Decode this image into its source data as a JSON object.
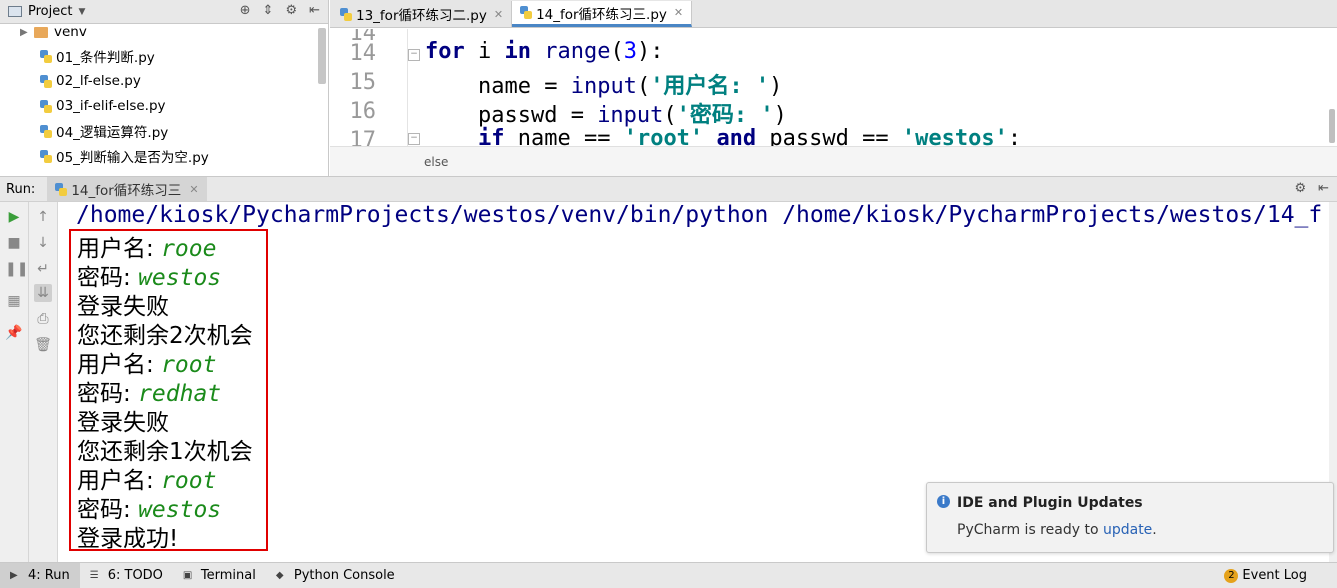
{
  "project_panel": {
    "title": "Project",
    "items": [
      {
        "label": "venv",
        "type": "folder"
      },
      {
        "label": "01_条件判断.py",
        "type": "file"
      },
      {
        "label": "02_lf-else.py",
        "type": "file"
      },
      {
        "label": "03_if-elif-else.py",
        "type": "file"
      },
      {
        "label": "04_逻辑运算符.py",
        "type": "file"
      },
      {
        "label": "05_判断输入是否为空.py",
        "type": "file"
      }
    ]
  },
  "editor": {
    "tabs": [
      {
        "label": "13_for循环练习二.py",
        "active": false
      },
      {
        "label": "14_for循环练习三.py",
        "active": true
      }
    ],
    "line_numbers": [
      "14",
      "15",
      "16",
      "17"
    ],
    "code": {
      "line14": {
        "kw1": "for",
        "var": " i ",
        "kw2": "in",
        "fn": " range",
        "p1": "(",
        "num": "3",
        "p2": "):"
      },
      "line15": {
        "indent": "    name = ",
        "fn": "input",
        "p1": "(",
        "str": "'用户名: '",
        "p2": ")"
      },
      "line16": {
        "indent": "    passwd = ",
        "fn": "input",
        "p1": "(",
        "str": "'密码: '",
        "p2": ")"
      },
      "line17": {
        "indent": "    ",
        "kw1": "if",
        "mid1": " name == ",
        "str1": "'root'",
        "sp": " ",
        "kw2": "and",
        "mid2": " passwd == ",
        "str2": "'westos'",
        "end": ":"
      }
    },
    "breadcrumb": "else"
  },
  "run_panel": {
    "label": "Run:",
    "tab_label": "14_for循环练习三",
    "command": "/home/kiosk/PycharmProjects/westos/venv/bin/python /home/kiosk/PycharmProjects/westos/14_f",
    "output": [
      {
        "prompt": "用户名: ",
        "input": "rooe"
      },
      {
        "prompt": "密码: ",
        "input": "westos"
      },
      {
        "prompt": "登录失败",
        "input": ""
      },
      {
        "prompt": "您还剩余2次机会",
        "input": ""
      },
      {
        "prompt": "用户名: ",
        "input": "root"
      },
      {
        "prompt": "密码: ",
        "input": "redhat"
      },
      {
        "prompt": "登录失败",
        "input": ""
      },
      {
        "prompt": "您还剩余1次机会",
        "input": ""
      },
      {
        "prompt": "用户名: ",
        "input": "root"
      },
      {
        "prompt": "密码: ",
        "input": "westos"
      },
      {
        "prompt": "登录成功!",
        "input": ""
      }
    ]
  },
  "notification": {
    "title": "IDE and Plugin Updates",
    "body_text": "PyCharm is ready to ",
    "link_text": "update",
    "body_end": "."
  },
  "status_bar": {
    "run": "4: Run",
    "todo": "6: TODO",
    "terminal": "Terminal",
    "python_console": "Python Console",
    "event_log": "Event Log",
    "event_count": "2"
  },
  "colors": {
    "highlight_box": "#e00000",
    "input_text": "#1a8a1a",
    "command_text": "#000080"
  }
}
